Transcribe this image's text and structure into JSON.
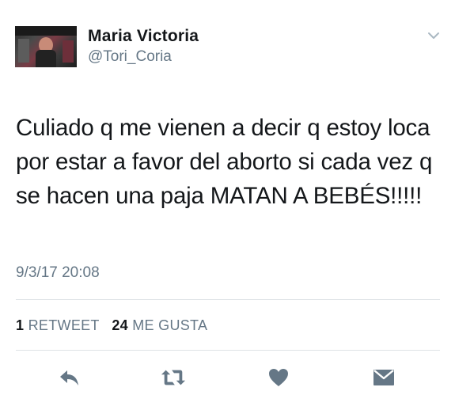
{
  "tweet": {
    "author": {
      "name": "Maria Victoria",
      "handle": "@Tori_Coria"
    },
    "text": "Culiado q me vienen a decir q estoy loca por estar a favor del aborto si cada vez q se hacen una paja MATAN A BEBÉS!!!!!",
    "timestamp": "9/3/17 20:08",
    "stats": {
      "retweets_count": "1",
      "retweets_label": "RETWEET",
      "likes_count": "24",
      "likes_label": "ME GUSTA"
    },
    "actions": [
      {
        "icon": "reply-icon"
      },
      {
        "icon": "retweet-icon"
      },
      {
        "icon": "heart-icon"
      },
      {
        "icon": "direct-message-icon"
      }
    ]
  },
  "colors": {
    "text": "#14171a",
    "secondary": "#657786",
    "icon": "#657786",
    "divider": "#dfe3e6"
  }
}
